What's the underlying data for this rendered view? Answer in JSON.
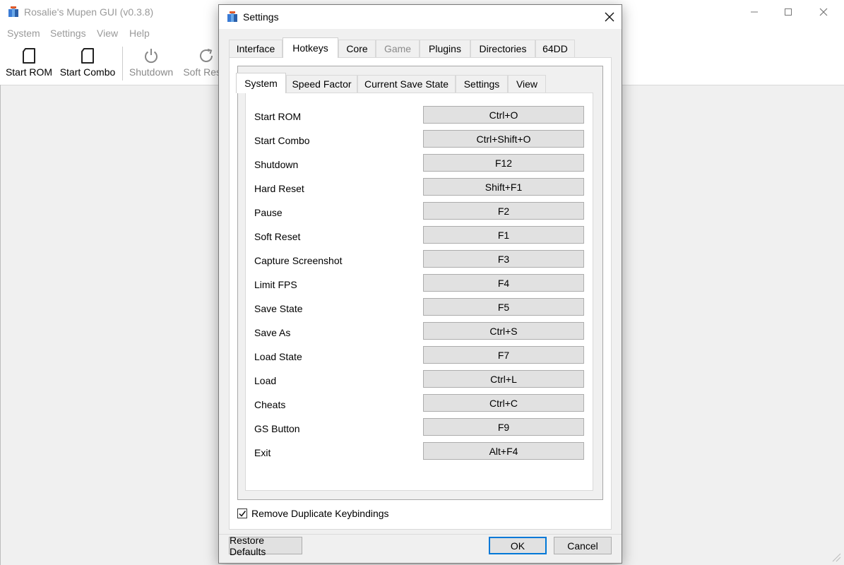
{
  "main_window": {
    "title": "Rosalie's Mupen GUI (v0.3.8)",
    "menu": [
      "System",
      "Settings",
      "View",
      "Help"
    ],
    "toolbar": [
      {
        "label": "Start ROM",
        "icon": "file-icon",
        "enabled": true
      },
      {
        "label": "Start Combo",
        "icon": "file-icon",
        "enabled": true
      },
      {
        "label": "Shutdown",
        "icon": "power-icon",
        "enabled": false
      },
      {
        "label": "Soft Reset",
        "icon": "refresh-icon",
        "enabled": false
      }
    ]
  },
  "dialog": {
    "title": "Settings",
    "tabs": [
      {
        "label": "Interface",
        "state": "normal"
      },
      {
        "label": "Hotkeys",
        "state": "active"
      },
      {
        "label": "Core",
        "state": "normal"
      },
      {
        "label": "Game",
        "state": "disabled"
      },
      {
        "label": "Plugins",
        "state": "normal"
      },
      {
        "label": "Directories",
        "state": "normal"
      },
      {
        "label": "64DD",
        "state": "normal"
      }
    ],
    "subtabs": [
      {
        "label": "System",
        "state": "active"
      },
      {
        "label": "Speed Factor",
        "state": "normal"
      },
      {
        "label": "Current Save State",
        "state": "normal"
      },
      {
        "label": "Settings",
        "state": "normal"
      },
      {
        "label": "View",
        "state": "normal"
      }
    ],
    "hotkeys": [
      {
        "action": "Start ROM",
        "key": "Ctrl+O"
      },
      {
        "action": "Start Combo",
        "key": "Ctrl+Shift+O"
      },
      {
        "action": "Shutdown",
        "key": "F12"
      },
      {
        "action": "Hard Reset",
        "key": "Shift+F1"
      },
      {
        "action": "Pause",
        "key": "F2"
      },
      {
        "action": "Soft Reset",
        "key": "F1"
      },
      {
        "action": "Capture Screenshot",
        "key": "F3"
      },
      {
        "action": "Limit FPS",
        "key": "F4"
      },
      {
        "action": "Save State",
        "key": "F5"
      },
      {
        "action": "Save As",
        "key": "Ctrl+S"
      },
      {
        "action": "Load State",
        "key": "F7"
      },
      {
        "action": "Load",
        "key": "Ctrl+L"
      },
      {
        "action": "Cheats",
        "key": "Ctrl+C"
      },
      {
        "action": "GS Button",
        "key": "F9"
      },
      {
        "action": "Exit",
        "key": "Alt+F4"
      }
    ],
    "remove_duplicates": {
      "label": "Remove Duplicate Keybindings",
      "checked": true
    },
    "buttons": {
      "restore_defaults": "Restore Defaults",
      "ok": "OK",
      "cancel": "Cancel"
    }
  },
  "colors": {
    "accent": "#0078d7",
    "disabled_text": "#8a8a8a",
    "button_face": "#e1e1e1",
    "window_bg": "#f0f0f0"
  }
}
